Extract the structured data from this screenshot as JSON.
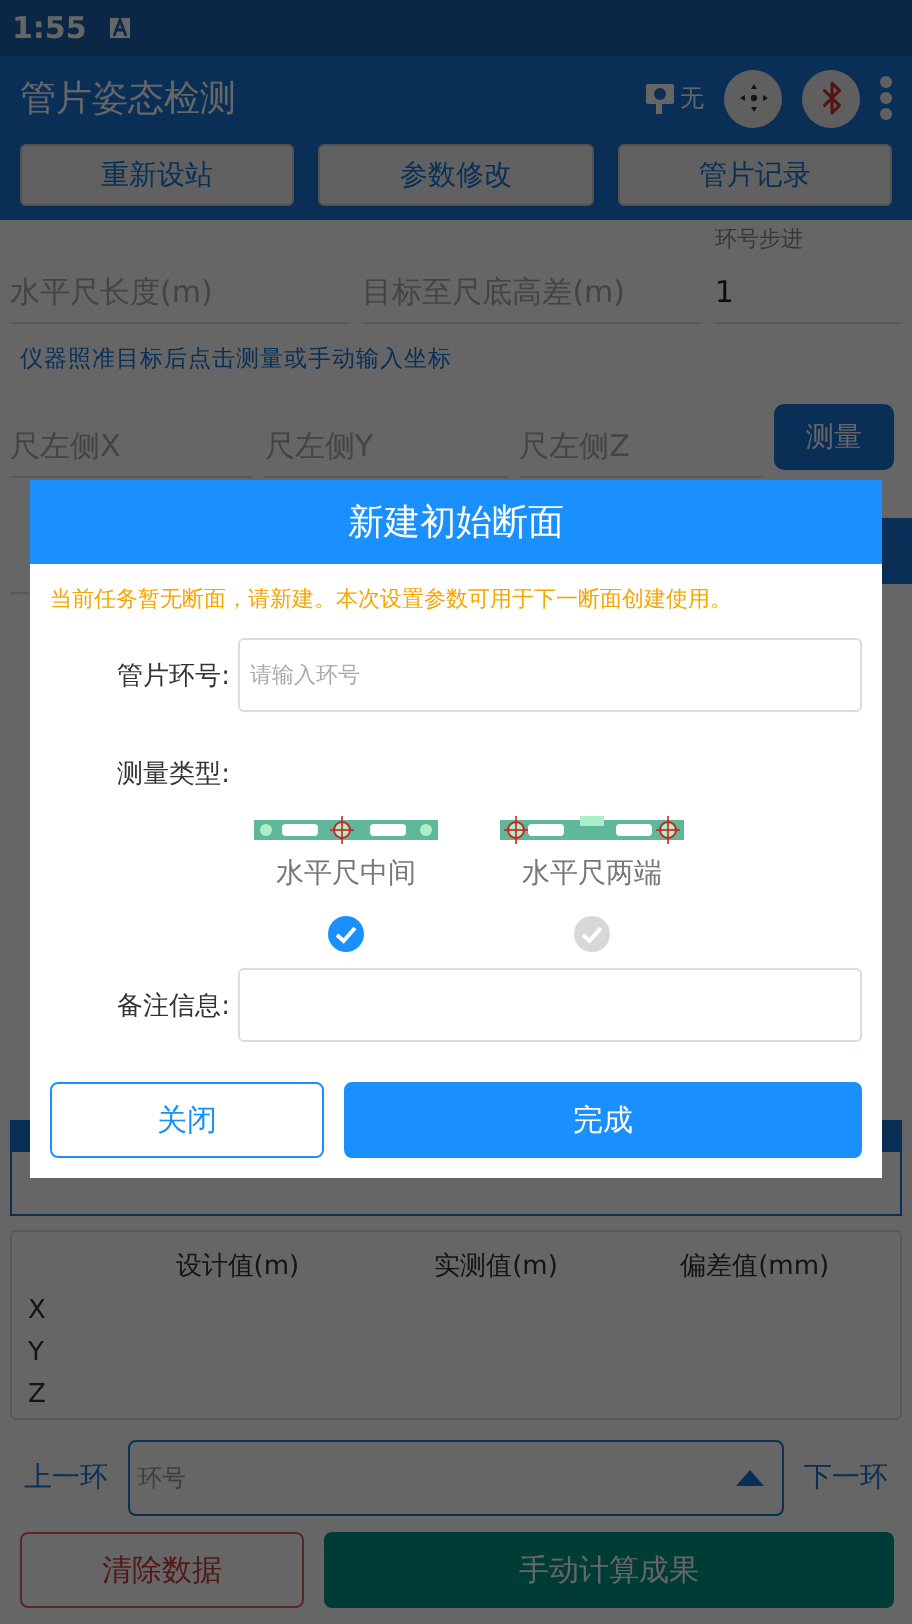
{
  "status_bar": {
    "time": "1:55"
  },
  "app_bar": {
    "title": "管片姿态检测",
    "prism_status": "无"
  },
  "toolbar_buttons": [
    "重新设站",
    "参数修改",
    "管片记录"
  ],
  "params": [
    {
      "placeholder": "水平尺长度(m)"
    },
    {
      "placeholder": "目标至尺底高差(m)"
    },
    {
      "label": "环号步进",
      "value": "1"
    }
  ],
  "hint": "仪器照准目标后点击测量或手动输入坐标",
  "left_coords": {
    "placeholders": [
      "尺左侧X",
      "尺左侧Y",
      "尺左侧Z"
    ],
    "button": "测量"
  },
  "results": {
    "columns": [
      "设计值(m)",
      "实测值(m)",
      "偏差值(mm)"
    ],
    "rows": [
      "X",
      "Y",
      "Z"
    ]
  },
  "ring_nav": {
    "prev": "上一环",
    "placeholder": "环号",
    "next": "下一环"
  },
  "actions": [
    "清除数据",
    "手动计算成果"
  ],
  "dialog": {
    "title": "新建初始断面",
    "notice": "当前任务暂无断面，请新建。本次设置参数可用于下一断面创建使用。",
    "ring_field": {
      "label": "管片环号:",
      "placeholder": "请输入环号"
    },
    "type_label": "测量类型:",
    "types": [
      {
        "label": "水平尺中间",
        "kind": "middle",
        "selected": true
      },
      {
        "label": "水平尺两端",
        "kind": "ends",
        "selected": false
      }
    ],
    "remark": {
      "label": "备注信息:"
    },
    "buttons": [
      {
        "label": "关闭",
        "kind": "outline"
      },
      {
        "label": "完成",
        "kind": "primary"
      }
    ]
  }
}
